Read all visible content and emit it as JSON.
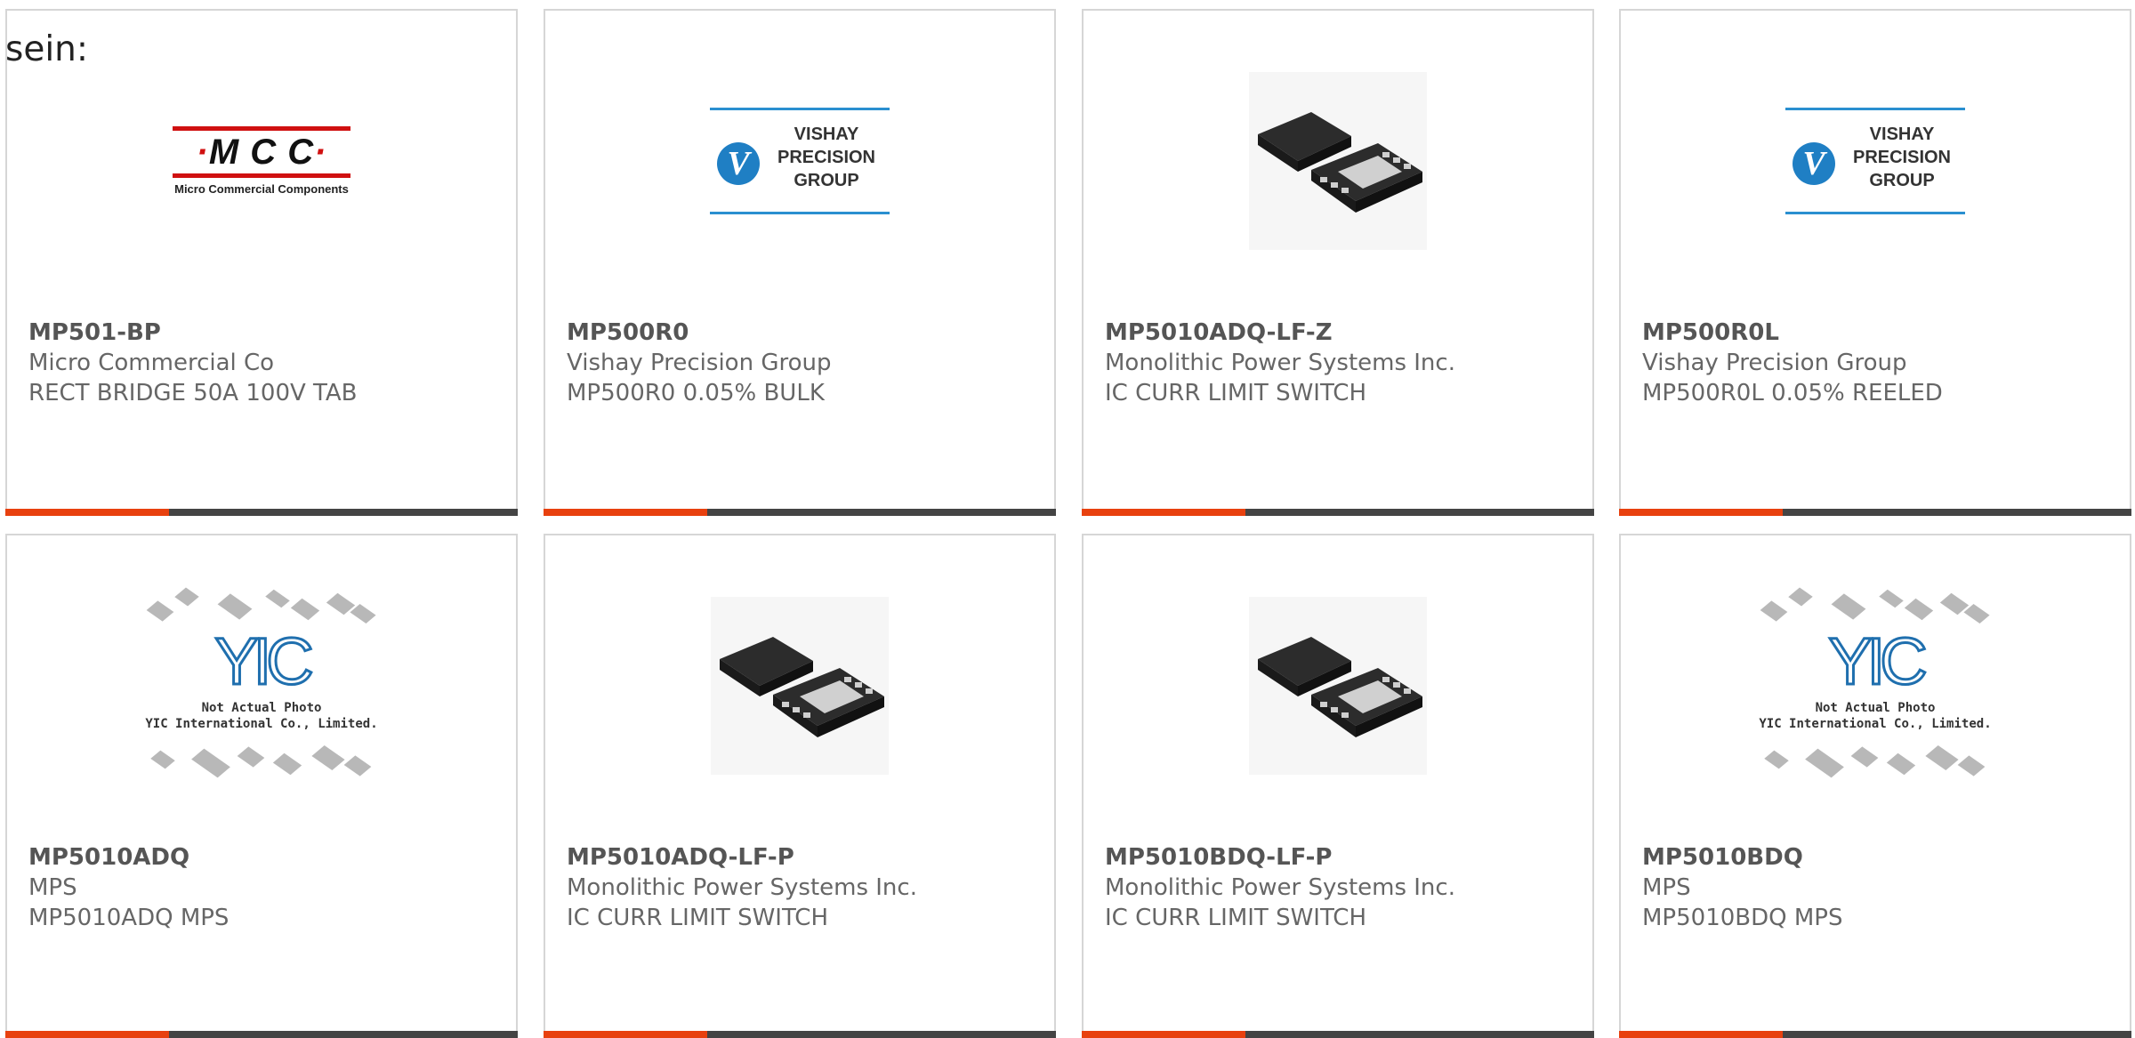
{
  "intro_text": "sein:",
  "colors": {
    "accent": "#e8410f",
    "bar": "#444444",
    "border": "#d6d6d6"
  },
  "products": [
    {
      "part_number": "MP501-BP",
      "manufacturer": "Micro Commercial Co",
      "description": "RECT BRIDGE 50A 100V TAB",
      "image": "mcc-logo"
    },
    {
      "part_number": "MP500R0",
      "manufacturer": "Vishay Precision Group",
      "description": "MP500R0 0.05% BULK",
      "image": "vishay-logo"
    },
    {
      "part_number": "MP5010ADQ-LF-Z",
      "manufacturer": "Monolithic Power Systems Inc.",
      "description": "IC CURR LIMIT SWITCH",
      "image": "chip-photo"
    },
    {
      "part_number": "MP500R0L",
      "manufacturer": "Vishay Precision Group",
      "description": "MP500R0L 0.05% REELED",
      "image": "vishay-logo"
    },
    {
      "part_number": "MP5010ADQ",
      "manufacturer": "MPS",
      "description": "MP5010ADQ MPS",
      "image": "yic-placeholder"
    },
    {
      "part_number": "MP5010ADQ-LF-P",
      "manufacturer": "Monolithic Power Systems Inc.",
      "description": "IC CURR LIMIT SWITCH",
      "image": "chip-photo"
    },
    {
      "part_number": "MP5010BDQ-LF-P",
      "manufacturer": "Monolithic Power Systems Inc.",
      "description": "IC CURR LIMIT SWITCH",
      "image": "chip-photo"
    },
    {
      "part_number": "MP5010BDQ",
      "manufacturer": "MPS",
      "description": "MP5010BDQ MPS",
      "image": "yic-placeholder"
    }
  ],
  "logos": {
    "mcc_letters": "M C C",
    "mcc_sub": "Micro Commercial Components",
    "vishay_lines": [
      "VISHAY",
      "PRECISION",
      "GROUP"
    ],
    "yic_mark": "YIC",
    "yic_note_1": "Not Actual Photo",
    "yic_note_2": "YIC International Co., Limited."
  }
}
